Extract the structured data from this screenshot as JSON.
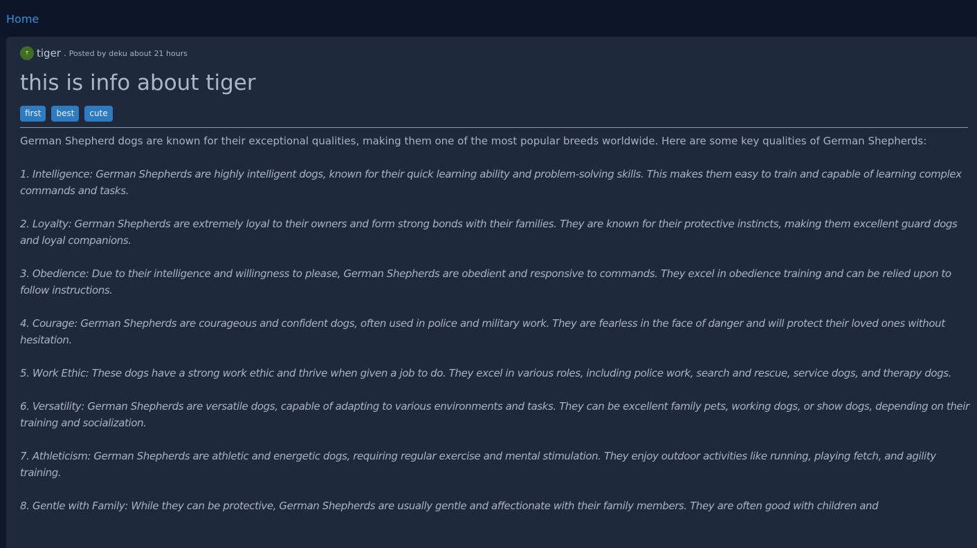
{
  "nav": {
    "home_label": "Home"
  },
  "post": {
    "avatar_letter": "T",
    "community": "tiger",
    "separator": ".",
    "posted_by_label": "Posted by",
    "author": "deku",
    "time": "about 21 hours",
    "title": "this is info about tiger",
    "tags": [
      "first",
      "best",
      "cute"
    ],
    "intro": "German Shepherd dogs are known for their exceptional qualities, making them one of the most popular breeds worldwide. Here are some key qualities of German Shepherds:",
    "points": [
      "1. Intelligence: German Shepherds are highly intelligent dogs, known for their quick learning ability and problem-solving skills. This makes them easy to train and capable of learning complex commands and tasks.",
      "2. Loyalty: German Shepherds are extremely loyal to their owners and form strong bonds with their families. They are known for their protective instincts, making them excellent guard dogs and loyal companions.",
      "3. Obedience: Due to their intelligence and willingness to please, German Shepherds are obedient and responsive to commands. They excel in obedience training and can be relied upon to follow instructions.",
      "4. Courage: German Shepherds are courageous and confident dogs, often used in police and military work. They are fearless in the face of danger and will protect their loved ones without hesitation.",
      "5. Work Ethic: These dogs have a strong work ethic and thrive when given a job to do. They excel in various roles, including police work, search and rescue, service dogs, and therapy dogs.",
      "6. Versatility: German Shepherds are versatile dogs, capable of adapting to various environments and tasks. They can be excellent family pets, working dogs, or show dogs, depending on their training and socialization.",
      "7. Athleticism: German Shepherds are athletic and energetic dogs, requiring regular exercise and mental stimulation. They enjoy outdoor activities like running, playing fetch, and agility training.",
      "8. Gentle with Family: While they can be protective, German Shepherds are usually gentle and affectionate with their family members. They are often good with children and"
    ]
  },
  "colors": {
    "background": "#0f172a",
    "card": "#1e293b",
    "link": "#3b8fd9",
    "tag": "#2f7bbf",
    "avatar": "#3f6d23"
  }
}
